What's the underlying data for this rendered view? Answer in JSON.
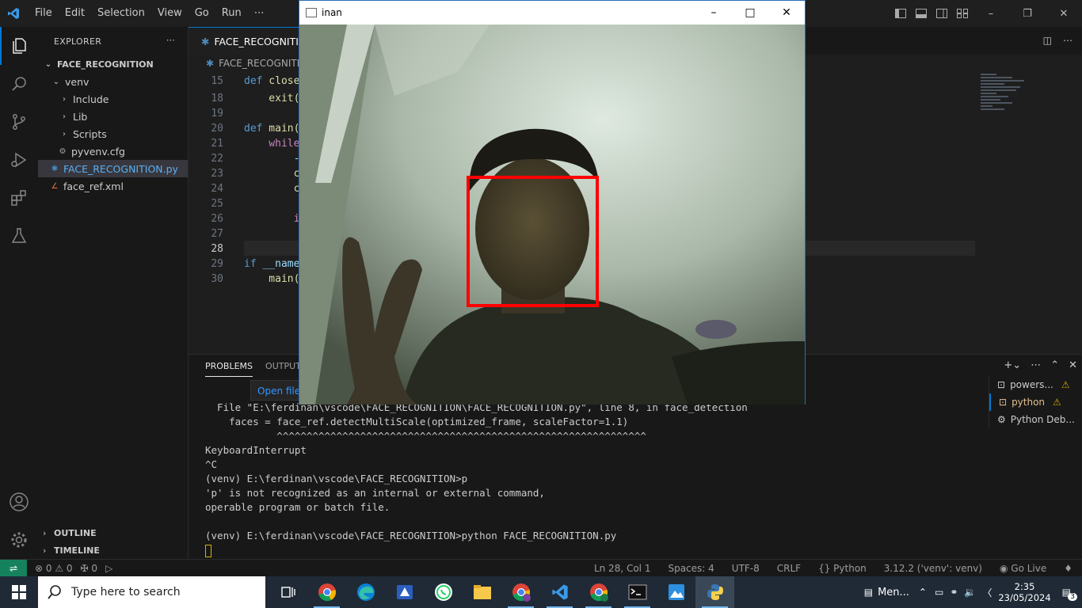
{
  "titlebar": {
    "menu": [
      "File",
      "Edit",
      "Selection",
      "View",
      "Go",
      "Run",
      "⋯"
    ]
  },
  "explorer": {
    "title": "EXPLORER",
    "root": "FACE_RECOGNITION",
    "venv": "venv",
    "include": "Include",
    "lib": "Lib",
    "scripts": "Scripts",
    "pyvenv": "pyvenv.cfg",
    "main_file": "FACE_RECOGNITION.py",
    "xml_file": "face_ref.xml",
    "outline": "OUTLINE",
    "timeline": "TIMELINE"
  },
  "editor": {
    "tab": "FACE_RECOGNITION.py",
    "breadcrumb": "FACE_RECOGNITI",
    "lines": [
      {
        "n": "15",
        "kw": "def",
        "rest": " close"
      },
      {
        "n": "18",
        "kw": "",
        "rest": "    exit("
      },
      {
        "n": "19",
        "kw": "",
        "rest": ""
      },
      {
        "n": "20",
        "kw": "def",
        "rest": " main("
      },
      {
        "n": "21",
        "kw": "",
        "rest": "    while"
      },
      {
        "n": "22",
        "kw": "",
        "rest": "        -"
      },
      {
        "n": "23",
        "kw": "",
        "rest": "        c"
      },
      {
        "n": "24",
        "kw": "",
        "rest": "        c"
      },
      {
        "n": "25",
        "kw": "",
        "rest": ""
      },
      {
        "n": "26",
        "kw": "",
        "rest": "        i"
      },
      {
        "n": "27",
        "kw": "",
        "rest": ""
      },
      {
        "n": "28",
        "kw": "",
        "rest": ""
      },
      {
        "n": "29",
        "kw": "if",
        "rest": " __name"
      },
      {
        "n": "30",
        "kw": "",
        "rest": "    main("
      }
    ]
  },
  "panel": {
    "tabs": [
      "PROBLEMS",
      "OUTPUT"
    ],
    "open_file": "Open file",
    "terminal_lines": [
      "  File \"E:\\ferdinan\\vscode\\FACE_RECOGNITION\\FACE_RECOGNITION.py\", line 8, in face_detection",
      "    faces = face_ref.detectMultiScale(optimized_frame, scaleFactor=1.1)",
      "            ^^^^^^^^^^^^^^^^^^^^^^^^^^^^^^^^^^^^^^^^^^^^^^^^^^^^^^^^^^^^^^",
      "KeyboardInterrupt",
      "^C",
      "(venv) E:\\ferdinan\\vscode\\FACE_RECOGNITION>p",
      "'p' is not recognized as an internal or external command,",
      "operable program or batch file.",
      "",
      "(venv) E:\\ferdinan\\vscode\\FACE_RECOGNITION>python FACE_RECOGNITION.py"
    ],
    "terminals": [
      {
        "label": "powers...",
        "warn": true
      },
      {
        "label": "python",
        "warn": true
      },
      {
        "label": "Python Deb...",
        "warn": false
      }
    ]
  },
  "statusbar": {
    "errors": "0",
    "warnings": "0",
    "ports": "0",
    "position": "Ln 28, Col 1",
    "spaces": "Spaces: 4",
    "encoding": "UTF-8",
    "eol": "CRLF",
    "language": "Python",
    "interpreter": "3.12.2 ('venv': venv)",
    "golive": "Go Live"
  },
  "camera_window": {
    "title": "inan",
    "detection_box_color": "#ff0000"
  },
  "taskbar": {
    "search_placeholder": "Type here to search",
    "tray_label": "Men...",
    "time": "2:35",
    "date": "23/05/2024",
    "notifications": "3",
    "apps": [
      "task-view-icon",
      "chrome-icon",
      "edge-icon",
      "app-icon",
      "whatsapp-icon",
      "file-explorer-icon",
      "chrome-profile-icon",
      "vscode-icon",
      "chrome-profile-2-icon",
      "terminal-icon",
      "photos-icon",
      "python-icon"
    ]
  },
  "colors": {
    "accent": "#0078d4",
    "warning": "#cca700",
    "remote": "#16825d"
  }
}
